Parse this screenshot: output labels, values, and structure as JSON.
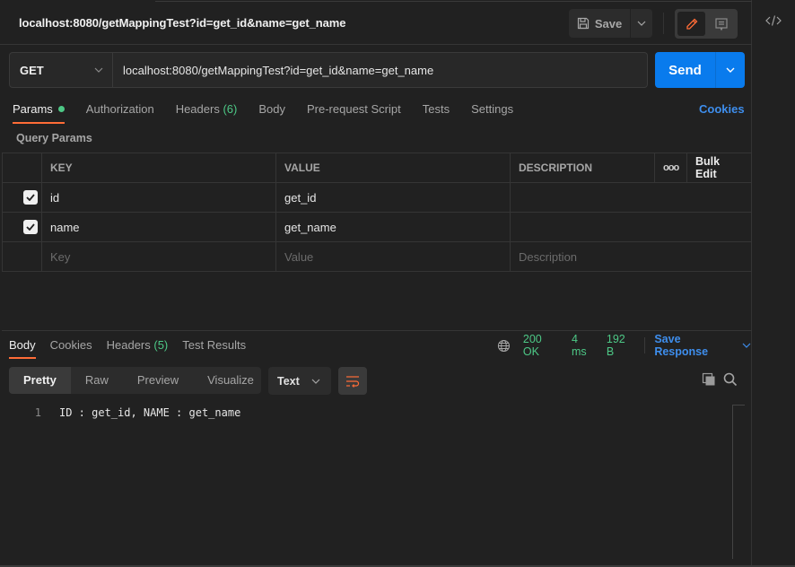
{
  "header": {
    "title": "localhost:8080/getMappingTest?id=get_id&name=get_name",
    "save_label": "Save"
  },
  "request": {
    "method": "GET",
    "url": "localhost:8080/getMappingTest?id=get_id&name=get_name",
    "send_label": "Send"
  },
  "request_tabs": [
    {
      "label": "Params",
      "active": true,
      "indicator": "green-dot"
    },
    {
      "label": "Authorization"
    },
    {
      "label": "Headers",
      "count": "(6)"
    },
    {
      "label": "Body"
    },
    {
      "label": "Pre-request Script"
    },
    {
      "label": "Tests"
    },
    {
      "label": "Settings"
    }
  ],
  "cookies_link": "Cookies",
  "query_params": {
    "label": "Query Params",
    "columns": {
      "key": "KEY",
      "value": "VALUE",
      "description": "DESCRIPTION",
      "more": "ooo",
      "bulk_edit": "Bulk Edit"
    },
    "rows": [
      {
        "checked": true,
        "key": "id",
        "value": "get_id",
        "description": ""
      },
      {
        "checked": true,
        "key": "name",
        "value": "get_name",
        "description": ""
      }
    ],
    "placeholders": {
      "key": "Key",
      "value": "Value",
      "description": "Description"
    }
  },
  "response_tabs": [
    {
      "label": "Body",
      "active": true
    },
    {
      "label": "Cookies"
    },
    {
      "label": "Headers",
      "count": "(5)"
    },
    {
      "label": "Test Results"
    }
  ],
  "response_status": {
    "status": "200 OK",
    "time": "4 ms",
    "size": "192 B",
    "save_response": "Save Response"
  },
  "view_modes": [
    "Pretty",
    "Raw",
    "Preview",
    "Visualize"
  ],
  "format": "Text",
  "response_body": [
    {
      "line": "1",
      "text": "ID : get_id, NAME : get_name"
    }
  ],
  "colors": {
    "accent_orange": "#ff6c37",
    "send_blue": "#097bed",
    "link_blue": "#3e8eed",
    "status_green": "#4dc886",
    "background": "#212121"
  },
  "icons": {
    "save": "floppy-disk-icon",
    "edit": "pencil-icon",
    "comment": "comment-icon",
    "code": "code-icon",
    "globe": "globe-icon",
    "wrap": "wrap-lines-icon",
    "copy": "copy-icon",
    "search": "search-icon"
  }
}
